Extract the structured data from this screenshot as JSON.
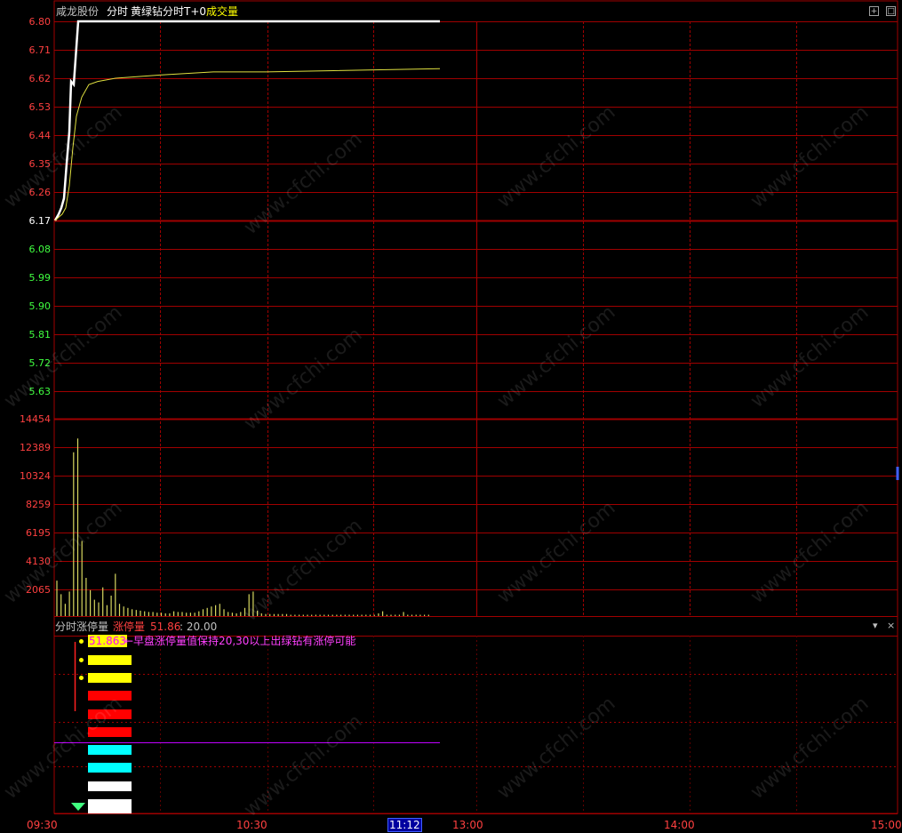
{
  "header": {
    "stock_name": "咸龙股份",
    "mode": "分时",
    "indicator": "黄绿钻分时T+0",
    "volume_label": "成交量"
  },
  "price_axis": {
    "labels": [
      "6.80",
      "6.71",
      "6.62",
      "6.53",
      "6.44",
      "6.35",
      "6.26",
      "6.17",
      "6.08",
      "5.99",
      "5.90",
      "5.81",
      "5.72",
      "5.63"
    ],
    "up_color": "#ff4040",
    "base_color": "#ffffff",
    "down_color": "#40ff40"
  },
  "volume_axis": {
    "labels": [
      "14454",
      "12389",
      "10324",
      "8259",
      "6195",
      "4130",
      "2065"
    ]
  },
  "lower_panel": {
    "title": "分时涨停量",
    "key": "涨停量",
    "value": "51.86",
    "threshold": ": 20.00",
    "highlight_value": "51.863",
    "note": "←早盘涨停量值保持20,30以上出绿钻有涨停可能",
    "blocks": [
      {
        "color": "#ffff00",
        "dot": true
      },
      {
        "color": "#ffff00",
        "dot": true
      },
      {
        "color": "#ff0000",
        "dot": false
      },
      {
        "color": "#ff0000",
        "dot": false
      },
      {
        "color": "#ff0000",
        "dot": false
      },
      {
        "color": "#00ffff",
        "dot": false
      },
      {
        "color": "#00ffff",
        "dot": false
      },
      {
        "color": "#ffffff",
        "dot": false
      },
      {
        "color": "#ffffff",
        "dot": false
      }
    ],
    "diamond_icon": "green-diamond-icon"
  },
  "time_axis": {
    "labels": [
      "09:30",
      "10:30",
      "11:12",
      "13:00",
      "14:00",
      "15:00"
    ],
    "cursor": "11:12"
  },
  "watermark": "www.cfchi.com",
  "chart_data": {
    "type": "line",
    "title": "",
    "ylim": [
      5.63,
      6.8
    ],
    "base_price": 6.17,
    "series": [
      {
        "values": [
          6.17,
          6.19,
          6.21,
          6.24,
          6.35,
          6.45,
          6.61,
          6.6,
          6.8,
          6.8,
          6.8,
          6.8,
          6.8
        ]
      },
      {
        "values": [
          6.17,
          6.18,
          6.19,
          6.21,
          6.28,
          6.4,
          6.5,
          6.56,
          6.6,
          6.61,
          6.62,
          6.63,
          6.64,
          6.64,
          6.65
        ]
      }
    ],
    "volume": {
      "ylim": [
        0,
        14454
      ],
      "values": [
        2600,
        1600,
        900,
        1800,
        12000,
        13000,
        5500,
        2800,
        1900,
        1200,
        1000,
        2100,
        800,
        1500,
        3100,
        900,
        700,
        600,
        500,
        450,
        400,
        350,
        300,
        300,
        250,
        250,
        200,
        200,
        350,
        300,
        300,
        250,
        250,
        250,
        350,
        500,
        600,
        700,
        800,
        900,
        500,
        300,
        250,
        200,
        300,
        600,
        1600,
        1800,
        400,
        200,
        150,
        150,
        150,
        150,
        150,
        150,
        100,
        100,
        100,
        100,
        100,
        100,
        100,
        100,
        100,
        100,
        100,
        100,
        100,
        100,
        100,
        100,
        100,
        100,
        100,
        100,
        100,
        200,
        350,
        100,
        100,
        100,
        100,
        300,
        100,
        100,
        100,
        100,
        100,
        100
      ]
    }
  }
}
